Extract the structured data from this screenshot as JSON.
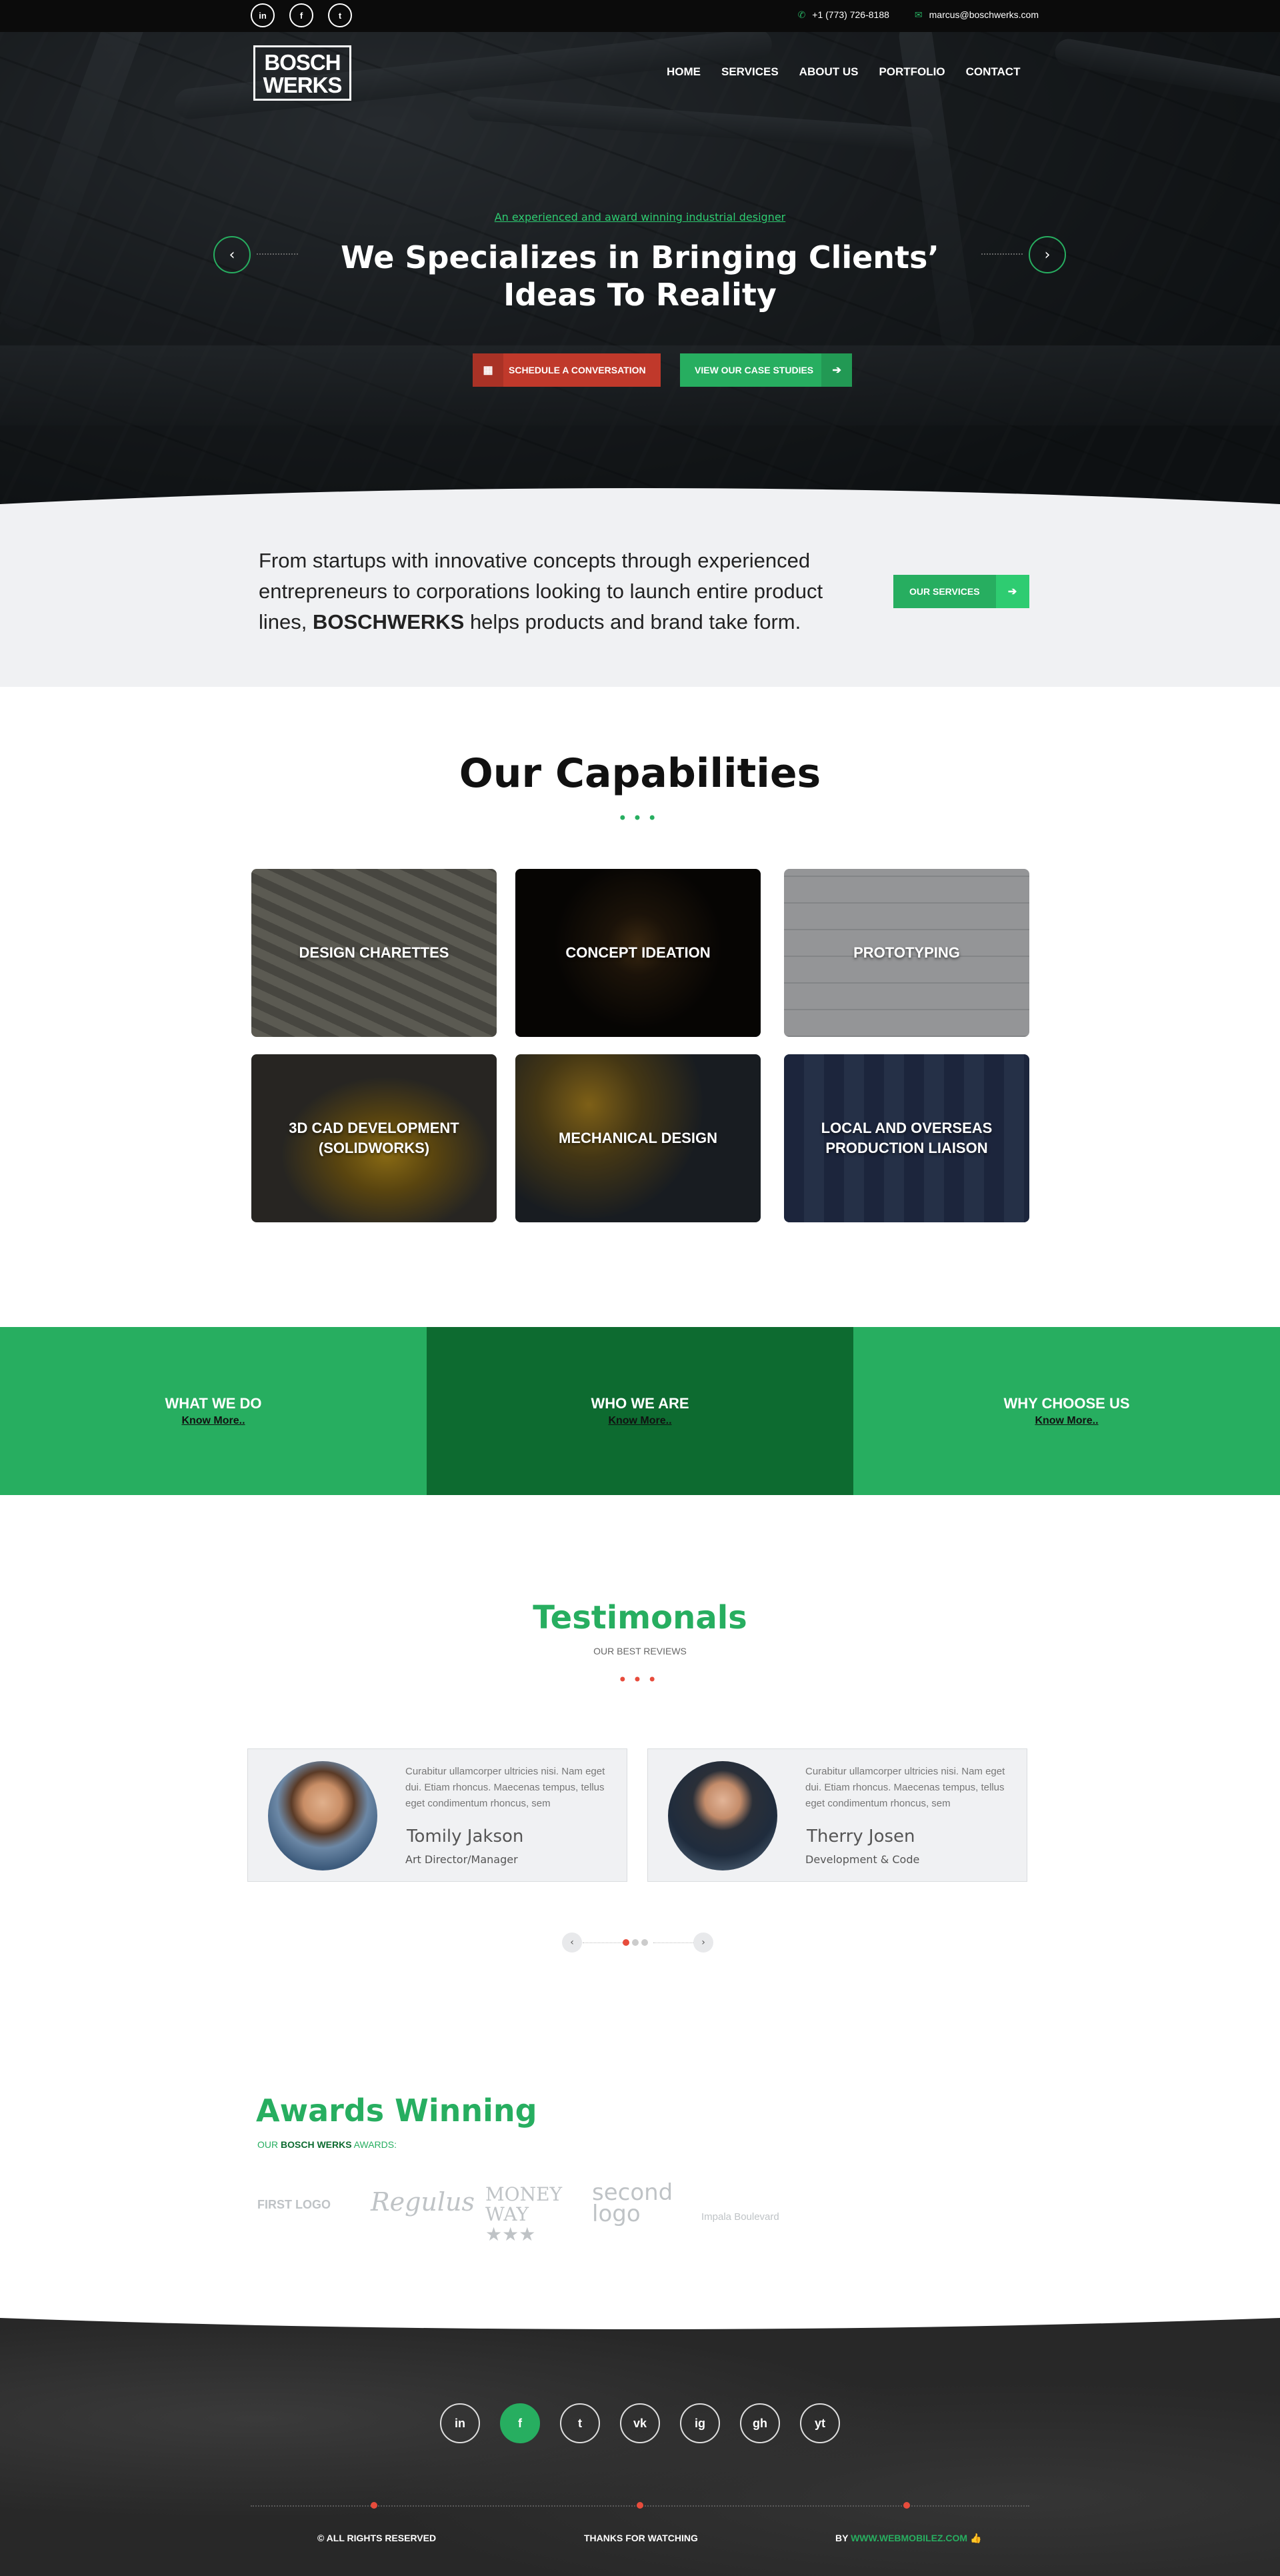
{
  "topbar": {
    "social": [
      "in",
      "f",
      "t"
    ],
    "social_icons": [
      "linkedin-icon",
      "facebook-icon",
      "twitter-icon"
    ],
    "phone": "+1 (773) 726-8188",
    "email": "marcus@boschwerks.com"
  },
  "brand": {
    "logo_line1": "BOSCH",
    "logo_line2": "WERKS"
  },
  "nav": [
    "HOME",
    "SERVICES",
    "ABOUT US",
    "PORTFOLIO",
    "CONTACT"
  ],
  "hero": {
    "kicker": "An experienced and award winning industrial designer",
    "title_line1": "We Specializes in Bringing Clients’",
    "title_line2": "Ideas To Reality",
    "btn_schedule": "SCHEDULE A CONVERSATION",
    "btn_cases": "VIEW OUR CASE STUDIES"
  },
  "intro": {
    "text_before": "From startups with innovative concepts through experienced entrepreneurs to corporations looking to launch entire product lines, ",
    "brand": "BOSCHWERKS",
    "text_after": " helps products and brand take form.",
    "button": "OUR SERVICES"
  },
  "capabilities": {
    "title": "Our Capabilities",
    "items": [
      "DESIGN CHARETTES",
      "CONCEPT IDEATION",
      "PROTOTYPING",
      "3D CAD DEVELOPMENT (SOLIDWORKS)",
      "MECHANICAL DESIGN",
      "LOCAL AND OVERSEAS PRODUCTION LIAISON"
    ]
  },
  "info_band": [
    {
      "title": "WHAT WE DO",
      "link": "Know More.."
    },
    {
      "title": "WHO WE ARE",
      "link": "Know More.."
    },
    {
      "title": "WHY CHOOSE US",
      "link": "Know More.."
    }
  ],
  "testimonials": {
    "title": "Testimonals",
    "subtitle": "OUR BEST REVIEWS",
    "items": [
      {
        "quote": "Curabitur ullamcorper ultricies nisi. Nam eget dui. Etiam rhoncus. Maecenas tempus, tellus eget condimentum rhoncus, sem",
        "name": "Tomily Jakson",
        "role": "Art Director/Manager"
      },
      {
        "quote": "Curabitur ullamcorper ultricies nisi. Nam eget dui. Etiam rhoncus. Maecenas tempus, tellus eget condimentum rhoncus, sem",
        "name": "Therry Josen",
        "role": "Development & Code"
      }
    ]
  },
  "awards": {
    "title": "Awards Winning",
    "sub_before": "OUR ",
    "sub_brand": "BOSCH WERKS",
    "sub_after": " AWARDS:",
    "logos": [
      "FIRST LOGO",
      "Regulus",
      "MONEY WAY ★★★",
      "second logo",
      "Impala Boulevard"
    ]
  },
  "footer": {
    "icons": [
      "in",
      "f",
      "t",
      "vk",
      "ig",
      "gh",
      "yt"
    ],
    "icon_names": [
      "linkedin-icon",
      "facebook-icon",
      "twitter-icon",
      "vk-icon",
      "instagram-icon",
      "github-icon",
      "youtube-icon"
    ],
    "rights": "© ALL RIGHTS RESERVED",
    "thanks": "THANKS FOR WATCHING",
    "by": "BY ",
    "by_link": "WWW.WEBMOBILEZ.COM",
    "thumb": "👍"
  },
  "colors": {
    "green": "#27ae60",
    "dark_green": "#0d6b30",
    "red": "#c0392b",
    "dark": "#0b0b0b"
  }
}
